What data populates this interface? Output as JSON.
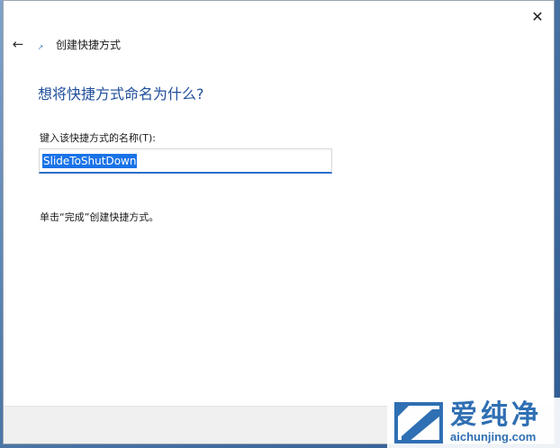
{
  "dialog": {
    "close_glyph": "✕",
    "back_glyph": "←",
    "title_icon_glyph": "↗",
    "title": "创建快捷方式",
    "heading": "想将快捷方式命名为什么?",
    "field_label": "键入该快捷方式的名称(T):",
    "field_value": "SlideToShutDown",
    "instruction": "单击“完成”创建快捷方式。"
  },
  "watermark": {
    "text": "爱纯净",
    "url": "aichunjing.com"
  },
  "colors": {
    "heading": "#1f4e9b",
    "selection": "#1a73e8",
    "input_focus_border": "#2b6fc9",
    "watermark": "#2f6fb3"
  }
}
